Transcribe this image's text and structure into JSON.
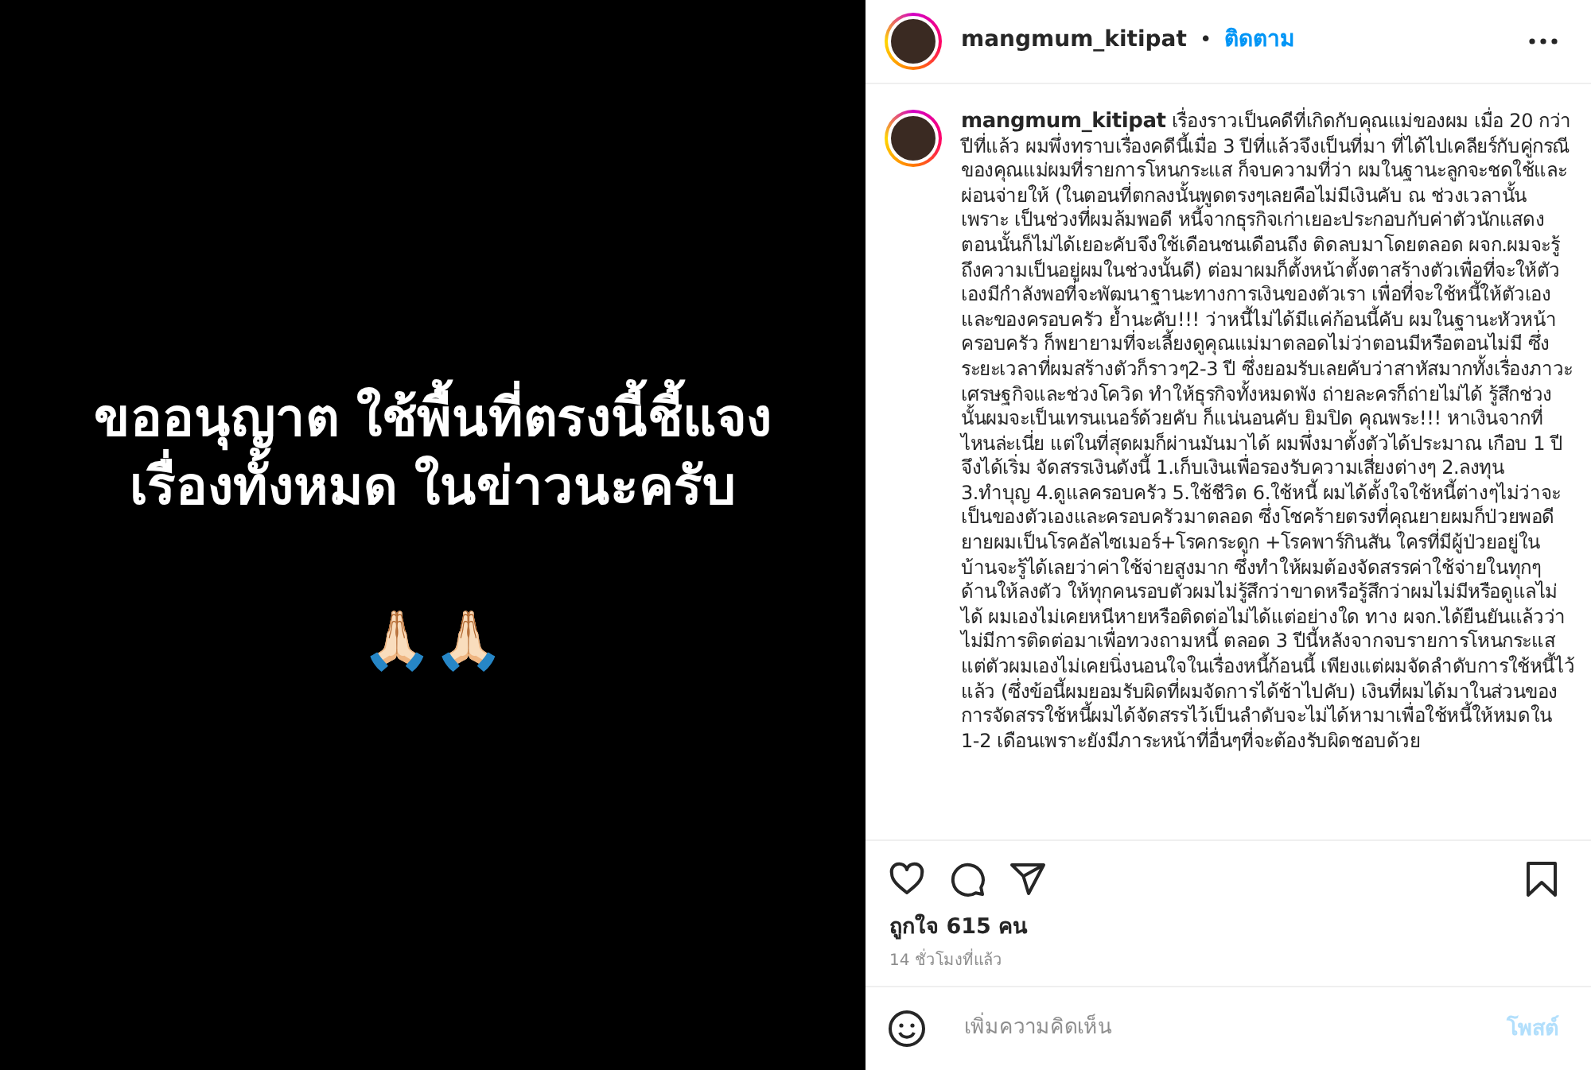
{
  "post_image": {
    "lines": [
      "ขออนุญาต ใช้พื้นที่ตรงนี้ชี้แจง",
      "เรื่องทั้งหมด ในข่าวนะครับ"
    ],
    "emoji": "🙏🏻🙏🏻"
  },
  "header": {
    "username": "mangmum_kitipat",
    "separator": "•",
    "follow": "ติดตาม"
  },
  "caption": {
    "username": "mangmum_kitipat",
    "text": "เรื่องราวเป็นคดีที่เกิดกับคุณแม่ของผม เมื่อ 20 กว่าปีที่แล้ว ผมพึ่งทราบเรื่องคดีนี้เมื่อ 3 ปีที่แล้วจึงเป็นที่มา ที่ได้ไปเคลียร์กับคู่กรณีของคุณแม่ผมที่รายการโหนกระแส ก็จบความที่ว่า ผมในฐานะลูกจะชดใช้และผ่อนจ่ายให้ (ในตอนที่ตกลงนั้นพูดตรงๆเลยคือไม่มีเงินคับ ณ ช่วงเวลานั้น เพราะ เป็นช่วงที่ผมล้มพอดี หนี้จากธุรกิจเก่าเยอะประกอบกับค่าตัวนักแสดงตอนนั้นก็ไม่ได้เยอะคับจึงใช้เดือนชนเดือนถึง ติดลบมาโดยตลอด ผจก.ผมจะรู้ถึงความเป็นอยู่ผมในช่วงนั้นดี) ต่อมาผมก็ตั้งหน้าตั้งตาสร้างตัวเพื่อที่จะให้ตัวเองมีกำลังพอที่จะพัฒนาฐานะทางการเงินของตัวเรา เพื่อที่จะใช้หนี้ให้ตัวเองและของครอบครัว ย้ำนะคับ!!! ว่าหนี้ไม่ได้มีแค่ก้อนนี้คับ ผมในฐานะหัวหน้าครอบครัว ก็พยายามที่จะเลี้ยงดูคุณแม่มาตลอดไม่ว่าตอนมีหรือตอนไม่มี ซึ่งระยะเวลาที่ผมสร้างตัวก็ราวๆ2-3 ปี ซึ่งยอมรับเลยคับว่าสาหัสมากทั้งเรื่องภาวะเศรษฐกิจและช่วงโควิด ทำให้ธุรกิจทั้งหมดพัง ถ่ายละครก็ถ่ายไม่ได้ รู้สึกช่วงนั้นผมจะเป็นเทรนเนอร์ด้วยคับ ก็แน่นอนคับ ยิมปิด คุณพระ!!! หาเงินจากที่ไหนล่ะเนี่ย แต่ในที่สุดผมก็ผ่านมันมาได้ ผมพึ่งมาตั้งตัวได้ประมาณ เกือบ 1 ปี จึงได้เริ่ม จัดสรรเงินดังนี้ 1.เก็บเงินเพื่อรองรับความเสี่ยงต่างๆ 2.ลงทุน 3.ทำบุญ 4.ดูแลครอบครัว 5.ใช้ชีวิต 6.ใช้หนี้ ผมได้ตั้งใจใช้หนี้ต่างๆไม่ว่าจะเป็นของตัวเองและครอบครัวมาตลอด ซึ่งโชคร้ายตรงที่คุณยายผมก็ป่วยพอดี ยายผมเป็นโรคอัลไซเมอร์+โรคกระดูก +โรคพาร์กินสัน ใครที่มีผู้ป่วยอยู่ในบ้านจะรู้ได้เลยว่าค่าใช้จ่ายสูงมาก ซึ่งทำให้ผมต้องจัดสรรค่าใช้จ่ายในทุกๆด้านให้ลงตัว ให้ทุกคนรอบตัวผมไม่รู้สึกว่าขาดหรือรู้สึกว่าผมไม่มีหรือดูแลไม่ได้ ผมเองไม่เคยหนีหายหรือติดต่อไม่ได้แต่อย่างใด ทาง ผจก.ได้ยืนยันแล้วว่าไม่มีการติดต่อมาเพื่อทวงถามหนี้ ตลอด 3 ปีนี้หลังจากจบรายการโหนกระแส แต่ตัวผมเองไม่เคยนิ่งนอนใจในเรื่องหนี้ก้อนนี้ เพียงแต่ผมจัดลำดับการใช้หนี้ไว้แล้ว (ซึ่งข้อนี้ผมยอมรับผิดที่ผมจัดการได้ช้าไปคับ) เงินที่ผมได้มาในส่วนของการจัดสรรใช้หนี้ผมได้จัดสรรไว้เป็นลำดับจะไม่ได้หามาเพื่อใช้หนี้ให้หมดใน 1-2 เดือนเพราะยังมีภาระหน้าที่อื่นๆที่จะต้องรับผิดชอบด้วย"
  },
  "likes": "ถูกใจ 615 คน",
  "time": "14 ชั่วโมงที่แล้ว",
  "comment": {
    "placeholder": "เพิ่มความคิดเห็น",
    "post_button": "โพสต์"
  }
}
